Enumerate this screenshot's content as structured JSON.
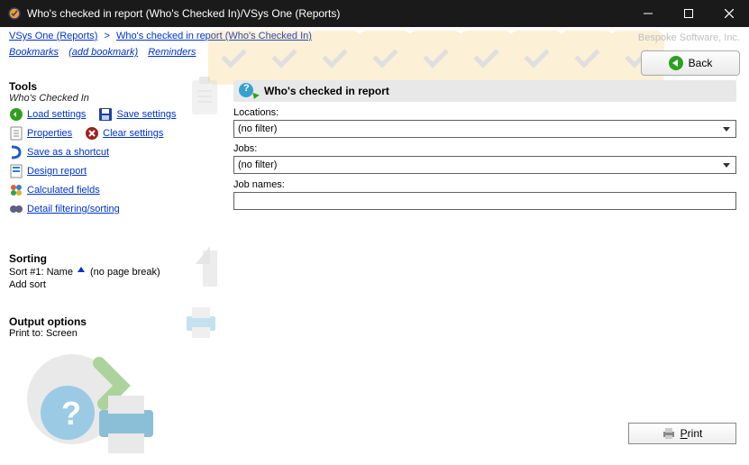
{
  "window": {
    "title": "Who's checked in report (Who's Checked In)/VSys One (Reports)"
  },
  "breadcrumb": {
    "root": "VSys One (Reports)",
    "sep": ">",
    "current": "Who's checked in report (Who's Checked In)"
  },
  "links": {
    "bookmarks": "Bookmarks",
    "add_bookmark": "(add bookmark)",
    "reminders": "Reminders"
  },
  "company": "Bespoke Software, Inc.",
  "back_btn": "Back",
  "tools": {
    "heading": "Tools",
    "subtitle": "Who's Checked In",
    "load_settings": "Load settings",
    "save_settings": "Save settings",
    "properties": "Properties",
    "clear_settings": "Clear settings",
    "save_as_shortcut": "Save as a shortcut",
    "design_report": "Design report",
    "calculated_fields": "Calculated fields",
    "detail_filtering": "Detail filtering/sorting"
  },
  "sorting": {
    "heading": "Sorting",
    "label": "Sort #1:",
    "field": "Name",
    "page_break": "(no page break)",
    "add_sort": "Add sort"
  },
  "output": {
    "heading": "Output options",
    "label": "Print to:",
    "target": "Screen"
  },
  "panel": {
    "heading": "Who's checked in report",
    "locations_label": "Locations:",
    "locations_value": "(no filter)",
    "jobs_label": "Jobs:",
    "jobs_value": "(no filter)",
    "job_names_label": "Job names:",
    "job_names_value": ""
  },
  "print_btn": "Print"
}
